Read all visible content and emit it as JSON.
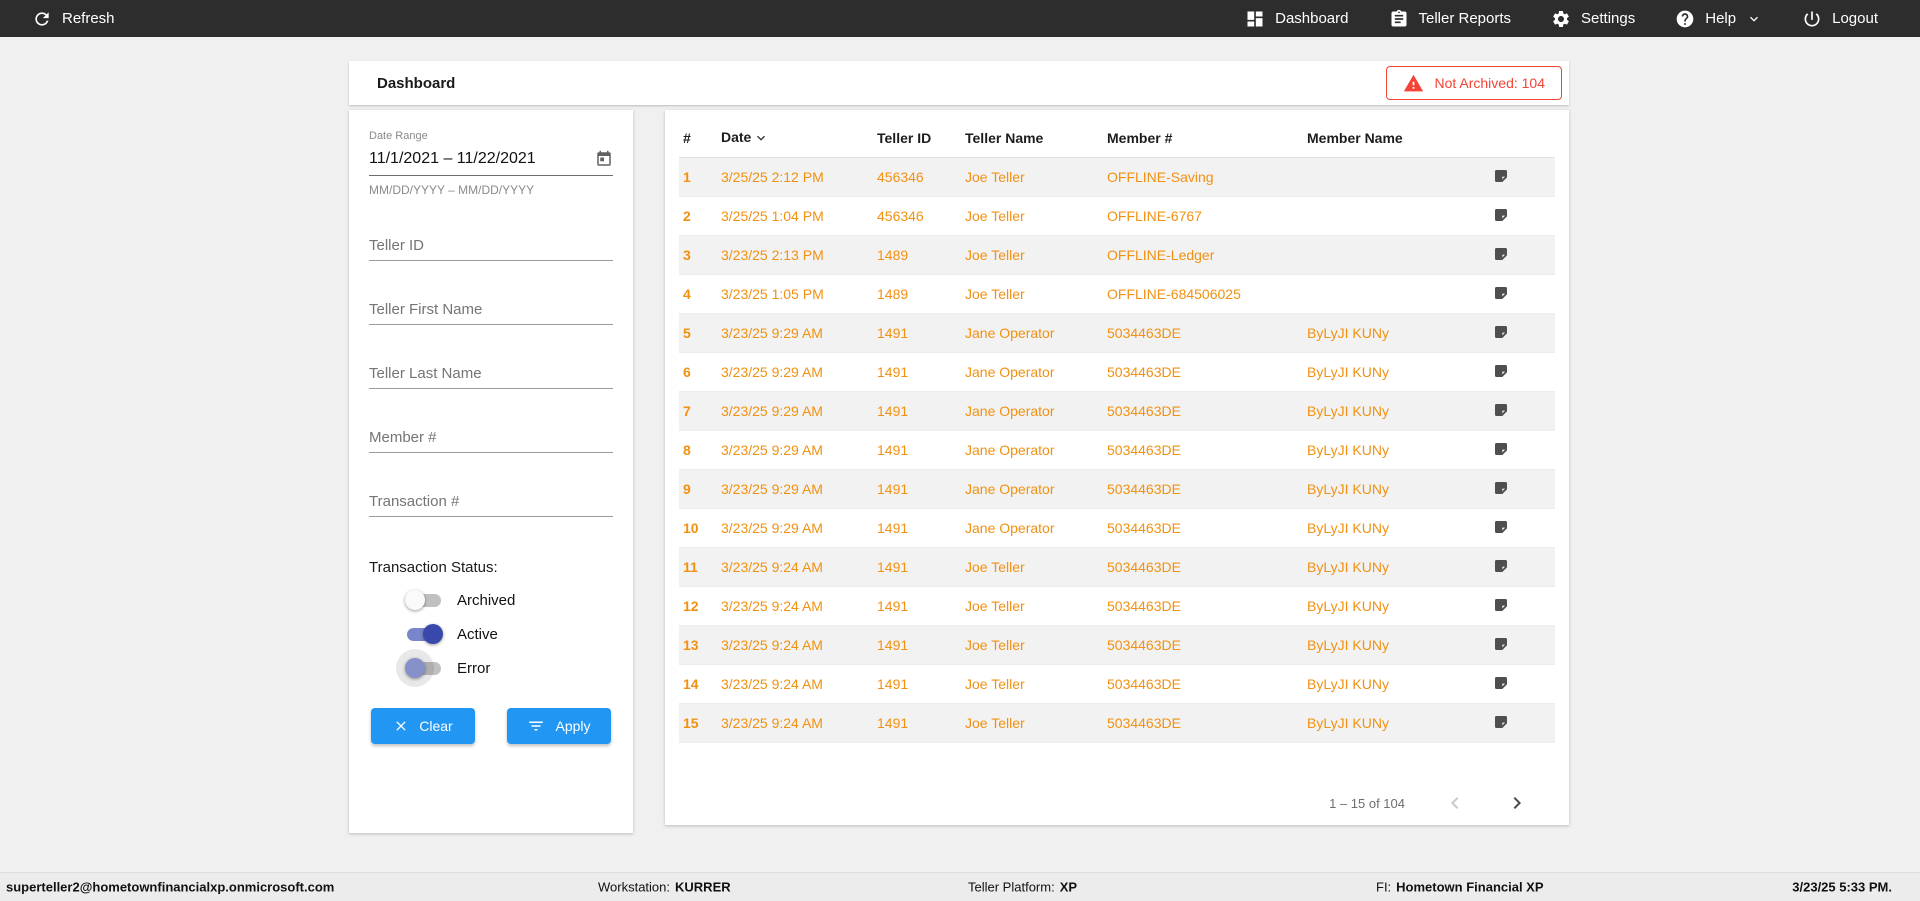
{
  "navbar": {
    "refresh_label": "Refresh",
    "items": [
      {
        "label": "Dashboard",
        "icon": "dashboard-icon"
      },
      {
        "label": "Teller Reports",
        "icon": "clipboard-icon"
      },
      {
        "label": "Settings",
        "icon": "gear-icon"
      },
      {
        "label": "Help",
        "icon": "help-icon"
      },
      {
        "label": "Logout",
        "icon": "power-icon"
      }
    ]
  },
  "header": {
    "title": "Dashboard",
    "alert_badge": "Not Archived: 104"
  },
  "filters": {
    "date_range": {
      "label": "Date Range",
      "value": "11/1/2021 – 11/22/2021",
      "helper": "MM/DD/YYYY – MM/DD/YYYY"
    },
    "inputs": [
      {
        "placeholder": "Teller ID"
      },
      {
        "placeholder": "Teller First Name"
      },
      {
        "placeholder": "Teller Last Name"
      },
      {
        "placeholder": "Member #"
      },
      {
        "placeholder": "Transaction #"
      }
    ],
    "status": {
      "label": "Transaction Status:",
      "toggles": [
        {
          "label": "Archived",
          "on": false,
          "halo": false
        },
        {
          "label": "Active",
          "on": true,
          "halo": false
        },
        {
          "label": "Error",
          "on": false,
          "halo": true
        }
      ]
    },
    "clear_label": "Clear",
    "apply_label": "Apply"
  },
  "table": {
    "columns": [
      "#",
      "Date",
      "Teller ID",
      "Teller Name",
      "Member #",
      "Member Name"
    ],
    "sort_column": "Date",
    "sort_direction": "desc",
    "rows": [
      {
        "num": "1",
        "date": "3/25/25 2:12 PM",
        "teller_id": "456346",
        "teller_name": "Joe Teller",
        "member_num": "OFFLINE-Saving",
        "member_name": ""
      },
      {
        "num": "2",
        "date": "3/25/25 1:04 PM",
        "teller_id": "456346",
        "teller_name": "Joe Teller",
        "member_num": "OFFLINE-6767",
        "member_name": ""
      },
      {
        "num": "3",
        "date": "3/23/25 2:13 PM",
        "teller_id": "1489",
        "teller_name": "Joe Teller",
        "member_num": "OFFLINE-Ledger",
        "member_name": ""
      },
      {
        "num": "4",
        "date": "3/23/25 1:05 PM",
        "teller_id": "1489",
        "teller_name": "Joe Teller",
        "member_num": "OFFLINE-684506025",
        "member_name": ""
      },
      {
        "num": "5",
        "date": "3/23/25 9:29 AM",
        "teller_id": "1491",
        "teller_name": "Jane Operator",
        "member_num": "5034463DE",
        "member_name": "ByLyJI KUNy"
      },
      {
        "num": "6",
        "date": "3/23/25 9:29 AM",
        "teller_id": "1491",
        "teller_name": "Jane Operator",
        "member_num": "5034463DE",
        "member_name": "ByLyJI KUNy"
      },
      {
        "num": "7",
        "date": "3/23/25 9:29 AM",
        "teller_id": "1491",
        "teller_name": "Jane Operator",
        "member_num": "5034463DE",
        "member_name": "ByLyJI KUNy"
      },
      {
        "num": "8",
        "date": "3/23/25 9:29 AM",
        "teller_id": "1491",
        "teller_name": "Jane Operator",
        "member_num": "5034463DE",
        "member_name": "ByLyJI KUNy"
      },
      {
        "num": "9",
        "date": "3/23/25 9:29 AM",
        "teller_id": "1491",
        "teller_name": "Jane Operator",
        "member_num": "5034463DE",
        "member_name": "ByLyJI KUNy"
      },
      {
        "num": "10",
        "date": "3/23/25 9:29 AM",
        "teller_id": "1491",
        "teller_name": "Jane Operator",
        "member_num": "5034463DE",
        "member_name": "ByLyJI KUNy"
      },
      {
        "num": "11",
        "date": "3/23/25 9:24 AM",
        "teller_id": "1491",
        "teller_name": "Joe Teller",
        "member_num": "5034463DE",
        "member_name": "ByLyJI KUNy"
      },
      {
        "num": "12",
        "date": "3/23/25 9:24 AM",
        "teller_id": "1491",
        "teller_name": "Joe Teller",
        "member_num": "5034463DE",
        "member_name": "ByLyJI KUNy"
      },
      {
        "num": "13",
        "date": "3/23/25 9:24 AM",
        "teller_id": "1491",
        "teller_name": "Joe Teller",
        "member_num": "5034463DE",
        "member_name": "ByLyJI KUNy"
      },
      {
        "num": "14",
        "date": "3/23/25 9:24 AM",
        "teller_id": "1491",
        "teller_name": "Joe Teller",
        "member_num": "5034463DE",
        "member_name": "ByLyJI KUNy"
      },
      {
        "num": "15",
        "date": "3/23/25 9:24 AM",
        "teller_id": "1491",
        "teller_name": "Joe Teller",
        "member_num": "5034463DE",
        "member_name": "ByLyJI KUNy"
      }
    ],
    "pagination": {
      "range_label": "1 – 15 of 104"
    }
  },
  "statusbar": {
    "user": "superteller2@hometownfinancialxp.onmicrosoft.com",
    "workstation_label": "Workstation:",
    "workstation_value": "KURRER",
    "platform_label": "Teller Platform:",
    "platform_value": "XP",
    "fi_label": "FI:",
    "fi_value": "Hometown Financial XP",
    "timestamp": "3/23/25 5:33 PM."
  },
  "colors": {
    "navbar_bg": "#2d2d2d",
    "accent_blue": "#2196f3",
    "alert_red": "#f44336",
    "row_orange": "#f29111",
    "toggle_active_indigo": "#3949ab"
  }
}
